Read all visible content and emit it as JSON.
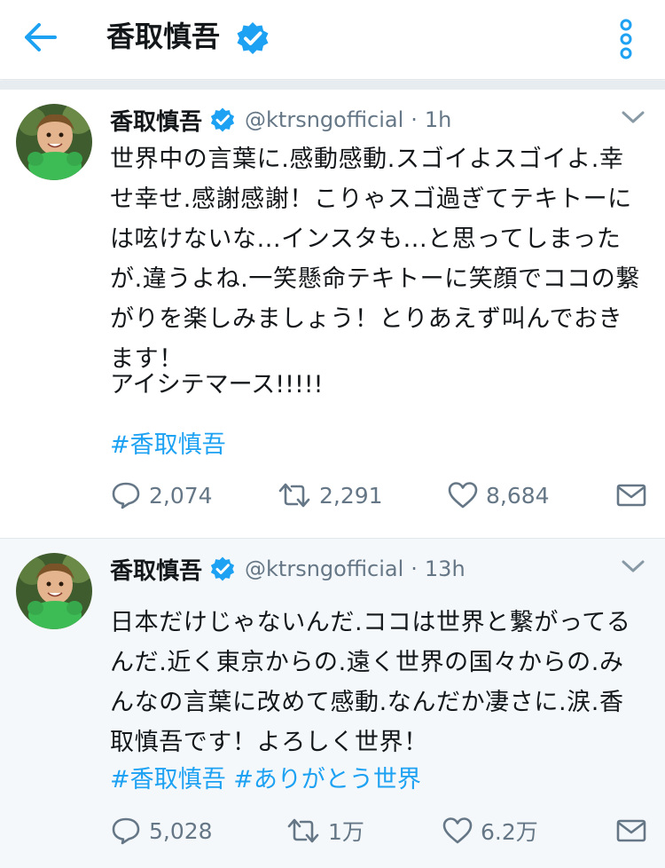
{
  "header": {
    "title": "香取慎吾",
    "back_icon": "arrow-left-icon",
    "verified_icon": "verified-badge-icon",
    "more_icon": "more-vertical-icon"
  },
  "colors": {
    "accent": "#1da1f2",
    "text": "#14171a",
    "secondary": "#657786",
    "divider": "#e6ecf0"
  },
  "tweets": [
    {
      "display_name": "香取慎吾",
      "handle": "@ktrsngofficial",
      "dot": "·",
      "time": "1h",
      "text_lines": [
        "世界中の言葉に.感動感動.スゴイよスゴイよ.幸",
        "せ幸せ.感謝感謝！こりゃスゴ過ぎてテキトーに",
        "は呟けないな...インスタも...と思ってしまった",
        "が.違うよね.一笑懸命テキトーに笑顔でココの繋",
        "がりを楽しみましょう！とりあえず叫んでおき",
        "ます！"
      ],
      "extra_line": "アイシテマース!!!!!",
      "hashtags": [
        "#香取慎吾"
      ],
      "replies": "2,074",
      "retweets": "2,291",
      "likes": "8,684"
    },
    {
      "display_name": "香取慎吾",
      "handle": "@ktrsngofficial",
      "dot": "·",
      "time": "13h",
      "text_lines": [
        "日本だけじゃないんだ.ココは世界と繋がってる",
        "んだ.近く東京からの.遠く世界の国々からの.み",
        "んなの言葉に改めて感動.なんだか凄さに.涙.香",
        "取慎吾です！よろしく世界！"
      ],
      "hashtags": [
        "#香取慎吾",
        "#ありがとう世界"
      ],
      "replies": "5,028",
      "retweets": "1万",
      "likes": "6.2万"
    }
  ]
}
